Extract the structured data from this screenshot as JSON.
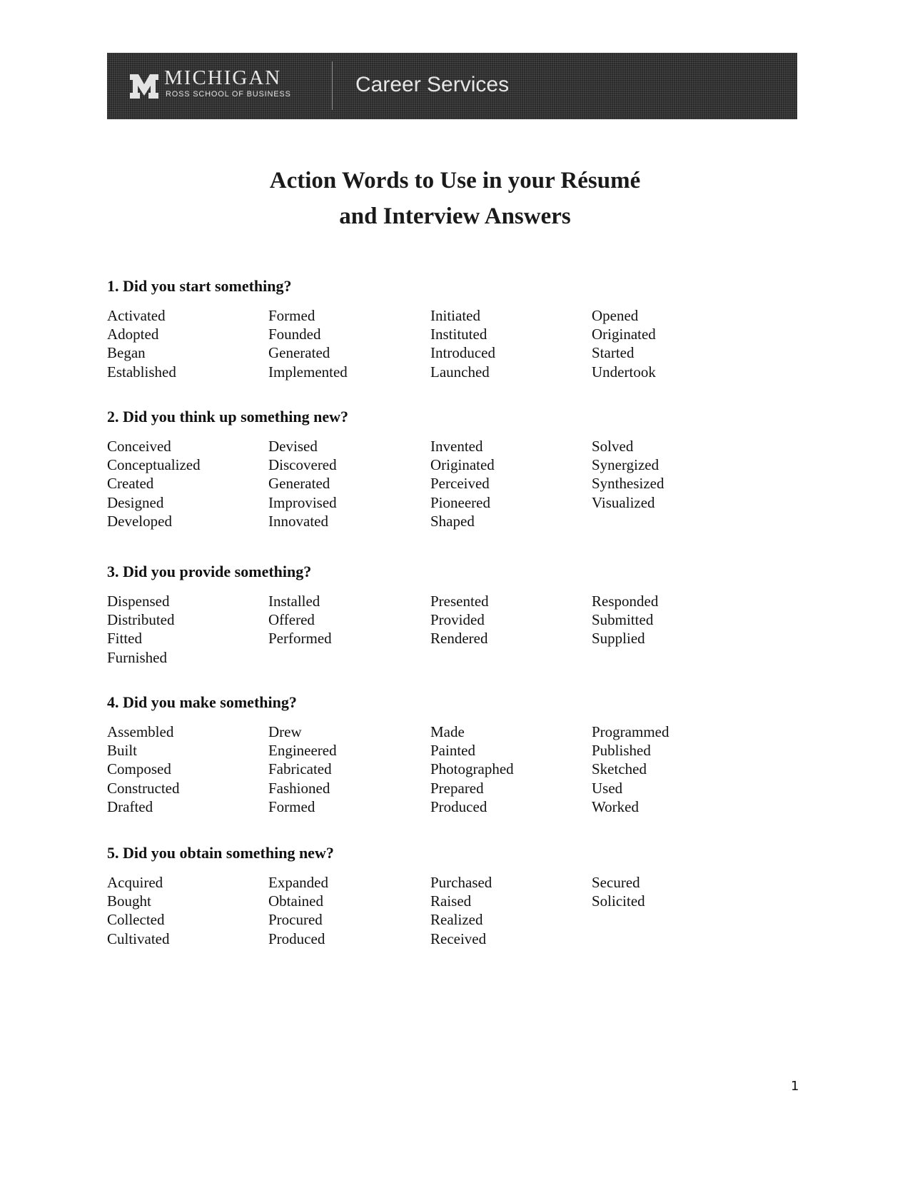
{
  "header": {
    "logo_wordmark": "MICHIGAN",
    "logo_subtitle": "ROSS SCHOOL OF BUSINESS",
    "department": "Career Services"
  },
  "title": {
    "line1": "Action Words to Use in your Résumé",
    "line2": "and Interview Answers"
  },
  "sections": [
    {
      "heading": "1. Did you start something?",
      "columns": [
        [
          "Activated",
          "Adopted",
          "Began",
          "Established"
        ],
        [
          "Formed",
          "Founded",
          "Generated",
          "Implemented"
        ],
        [
          "Initiated",
          "Instituted",
          "Introduced",
          "Launched"
        ],
        [
          "Opened",
          "Originated",
          "Started",
          "Undertook"
        ]
      ]
    },
    {
      "heading": "2. Did you think up something new?",
      "columns": [
        [
          "Conceived",
          "Conceptualized",
          "Created",
          "Designed",
          "Developed"
        ],
        [
          "Devised",
          "Discovered",
          "Generated",
          "Improvised",
          "Innovated"
        ],
        [
          "Invented",
          "Originated",
          "Perceived",
          "Pioneered",
          "Shaped"
        ],
        [
          "Solved",
          "Synergized",
          "Synthesized",
          "Visualized"
        ]
      ]
    },
    {
      "heading": "3. Did you provide something?",
      "columns": [
        [
          "Dispensed",
          "Distributed",
          "Fitted",
          "Furnished"
        ],
        [
          "Installed",
          "Offered",
          "Performed"
        ],
        [
          "Presented",
          "Provided",
          "Rendered"
        ],
        [
          "Responded",
          "Submitted",
          "Supplied"
        ]
      ]
    },
    {
      "heading": "4. Did you make something?",
      "columns": [
        [
          "Assembled",
          "Built",
          "Composed",
          "Constructed",
          "Drafted"
        ],
        [
          "Drew",
          "Engineered",
          "Fabricated",
          "Fashioned",
          "Formed"
        ],
        [
          "Made",
          "Painted",
          "Photographed",
          "Prepared",
          "Produced"
        ],
        [
          "Programmed",
          "Published",
          "Sketched",
          "Used",
          "Worked"
        ]
      ]
    },
    {
      "heading": "5. Did you obtain something new?",
      "columns": [
        [
          "Acquired",
          "Bought",
          "Collected",
          "Cultivated"
        ],
        [
          "Expanded",
          "Obtained",
          "Procured",
          "Produced"
        ],
        [
          "Purchased",
          "Raised",
          "Realized",
          "Received"
        ],
        [
          "Secured",
          "Solicited"
        ]
      ]
    }
  ],
  "footer": {
    "page_number": "1"
  }
}
